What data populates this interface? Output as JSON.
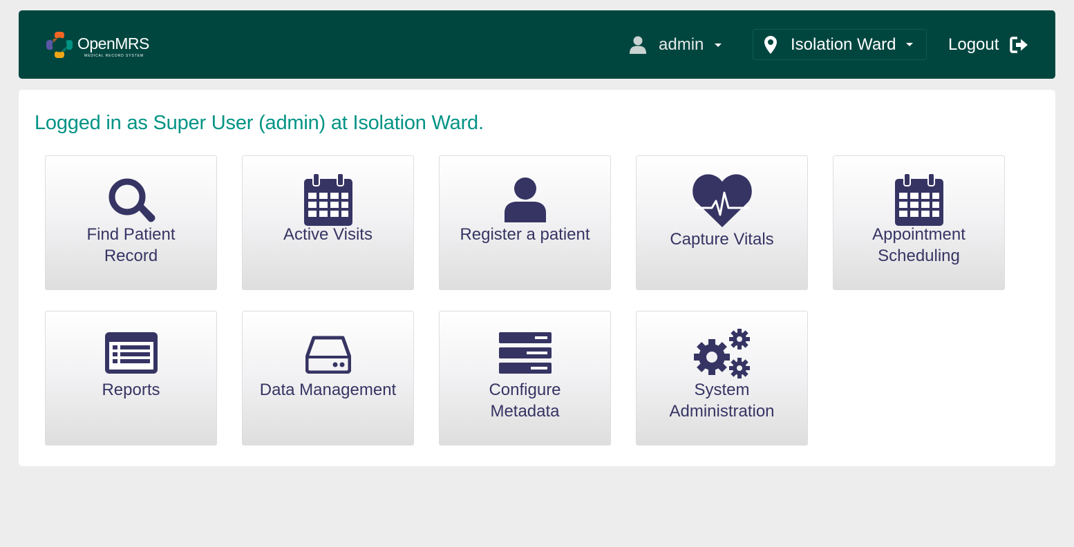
{
  "header": {
    "logo_text": "OpenMRS",
    "logo_subtext": "MEDICAL RECORD SYSTEM",
    "user": "admin",
    "location": "Isolation Ward",
    "logout": "Logout"
  },
  "welcome": "Logged in as Super User (admin) at Isolation Ward.",
  "apps": [
    {
      "line1": "Find Patient",
      "line2": "Record",
      "icon": "search-icon"
    },
    {
      "line1": "Active Visits",
      "line2": "",
      "icon": "calendar-icon"
    },
    {
      "line1": "Register a patient",
      "line2": "",
      "icon": "user-icon"
    },
    {
      "line1": "Capture Vitals",
      "line2": "",
      "icon": "heartbeat-icon"
    },
    {
      "line1": "Appointment",
      "line2": "Scheduling",
      "icon": "calendar-icon"
    },
    {
      "line1": "Reports",
      "line2": "",
      "icon": "list-alt-icon"
    },
    {
      "line1": "Data Management",
      "line2": "",
      "icon": "hdd-icon"
    },
    {
      "line1": "Configure",
      "line2": "Metadata",
      "icon": "server-icon"
    },
    {
      "line1": "System",
      "line2": "Administration",
      "icon": "cogs-icon"
    }
  ],
  "colors": {
    "header_bg": "#00463f",
    "welcome_text": "#009384",
    "icon": "#363463",
    "page_bg": "#ededed"
  }
}
